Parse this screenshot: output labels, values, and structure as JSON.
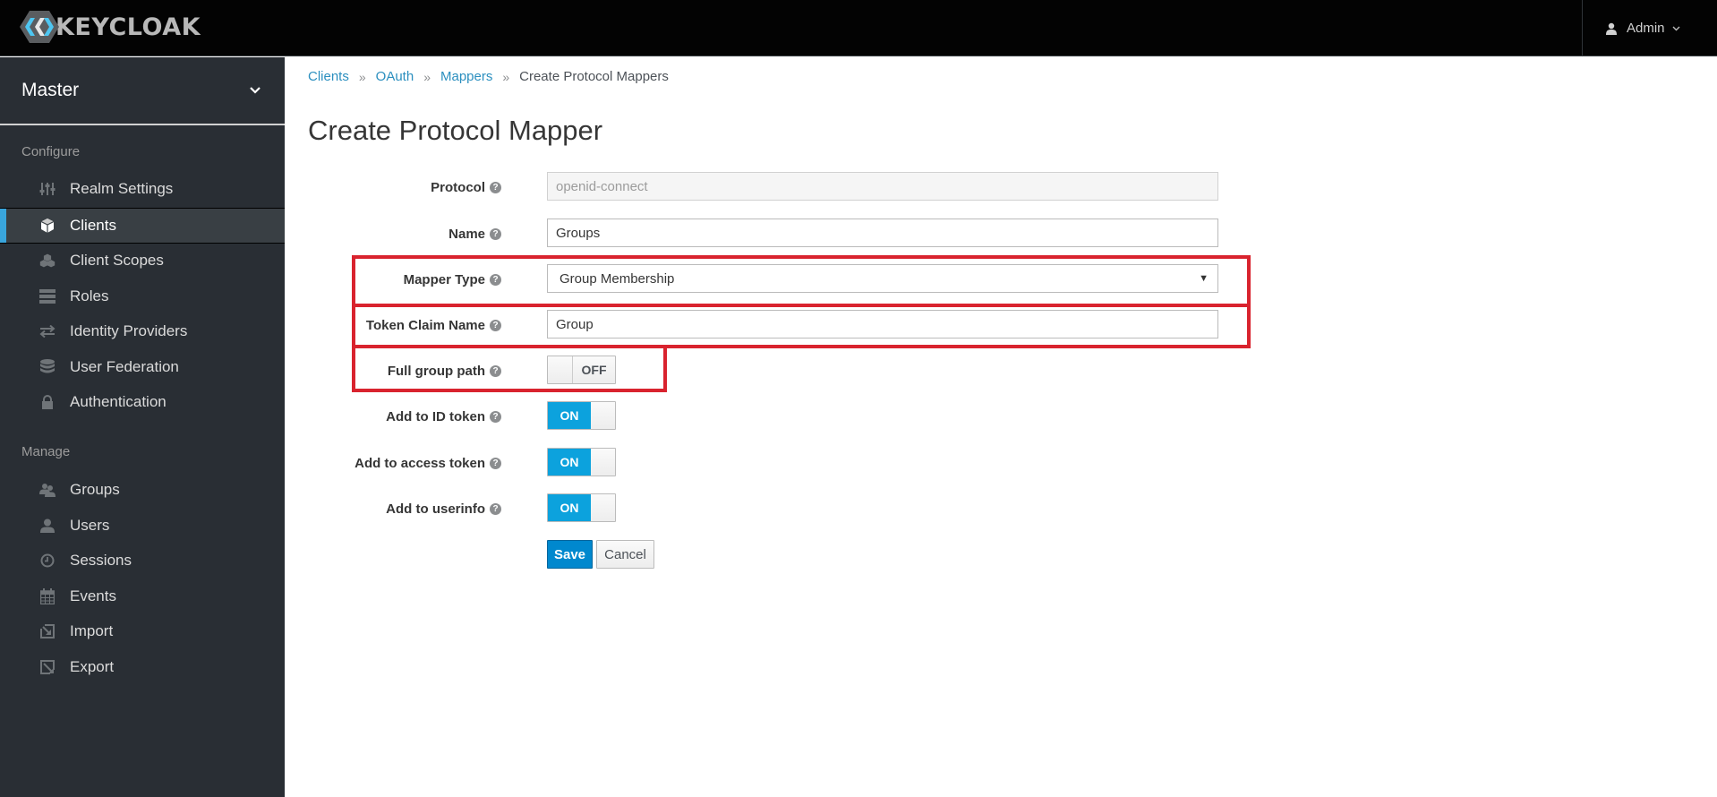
{
  "header": {
    "brand": "KEYCLOAK",
    "user_menu": "Admin"
  },
  "sidebar": {
    "realm": "Master",
    "sections": [
      {
        "title": "Configure",
        "items": [
          {
            "label": "Realm Settings",
            "icon": "sliders-icon",
            "active": false
          },
          {
            "label": "Clients",
            "icon": "cube-icon",
            "active": true
          },
          {
            "label": "Client Scopes",
            "icon": "cubes-icon",
            "active": false
          },
          {
            "label": "Roles",
            "icon": "list-icon",
            "active": false
          },
          {
            "label": "Identity Providers",
            "icon": "exchange-icon",
            "active": false
          },
          {
            "label": "User Federation",
            "icon": "database-icon",
            "active": false
          },
          {
            "label": "Authentication",
            "icon": "lock-icon",
            "active": false
          }
        ]
      },
      {
        "title": "Manage",
        "items": [
          {
            "label": "Groups",
            "icon": "users-icon",
            "active": false
          },
          {
            "label": "Users",
            "icon": "user-icon",
            "active": false
          },
          {
            "label": "Sessions",
            "icon": "clock-icon",
            "active": false
          },
          {
            "label": "Events",
            "icon": "calendar-icon",
            "active": false
          },
          {
            "label": "Import",
            "icon": "import-icon",
            "active": false
          },
          {
            "label": "Export",
            "icon": "export-icon",
            "active": false
          }
        ]
      }
    ]
  },
  "breadcrumb": {
    "items": [
      "Clients",
      "OAuth",
      "Mappers"
    ],
    "current": "Create Protocol Mappers",
    "separator": "»"
  },
  "page": {
    "title": "Create Protocol Mapper"
  },
  "form": {
    "protocol": {
      "label": "Protocol",
      "value": "openid-connect"
    },
    "name": {
      "label": "Name",
      "value": "Groups"
    },
    "mapper_type": {
      "label": "Mapper Type",
      "value": "Group Membership"
    },
    "token_claim_name": {
      "label": "Token Claim Name",
      "value": "Group"
    },
    "full_group_path": {
      "label": "Full group path",
      "state": "OFF"
    },
    "add_to_id_token": {
      "label": "Add to ID token",
      "state": "ON"
    },
    "add_to_access_token": {
      "label": "Add to access token",
      "state": "ON"
    },
    "add_to_userinfo": {
      "label": "Add to userinfo",
      "state": "ON"
    },
    "help_glyph": "?",
    "save_label": "Save",
    "cancel_label": "Cancel"
  },
  "colors": {
    "accent": "#39a5dc",
    "primary_button": "#0088ce",
    "toggle_on": "#0ca2dd",
    "highlight": "#d9232e",
    "sidebar_bg": "#292e34",
    "topbar_bg": "#030303"
  }
}
